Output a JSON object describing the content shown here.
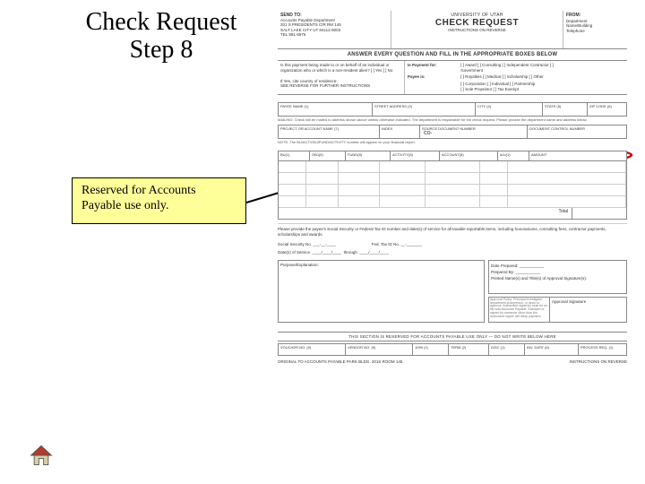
{
  "title_line1": "Check Request",
  "title_line2": "Step 8",
  "callout_text": "Reserved for Accounts Payable use only.",
  "form": {
    "header": {
      "send_to_label": "SEND TO:",
      "send_to_body": "Accounts Payable Department\n201 S PRESIDENTS CIR RM 145\nSALT LAKE CITY UT 84112-9003\nTEL 581-6976",
      "university": "UNIVERSITY OF UTAH",
      "title": "CHECK REQUEST",
      "subtitle": "INSTRUCTIONS ON REVERSE",
      "from_label": "FROM:",
      "from_body": "Department\nName/Building\nTelephone"
    },
    "banner": "ANSWER EVERY QUESTION AND FILL IN THE APPROPRIATE BOXES BELOW",
    "q1": {
      "left": "Is this payment being made to or on behalf of an individual or organization who or which is a non-resident alien?  [ ] Yes  [ ] No\n\nIf Yes, cite country of residence:\nSEE REVERSE FOR FURTHER INSTRUCTIONS",
      "pay_label": "Is Payment for:",
      "pay_opts": "[ ] Award  [ ] Consulting  [ ] Independent Contractor  [ ] Government\n[ ] Royalties  [ ] Medical  [ ] Scholarship  [ ] Other",
      "payee_label": "Payee is:",
      "payee_opts": "[ ] Corporation  [ ] Individual  [ ] Partnership\n[ ] Sole Proprietor  [ ] Tax Exempt"
    },
    "addr": {
      "c1": "PAYEE NAME (1)",
      "c2": "STREET ADDRESS (3)",
      "c3": "CITY (4)",
      "c4": "STATE (5)",
      "c5": "ZIP CODE (6)"
    },
    "blurb1": "MAILING: Check will be mailed to address shown above unless otherwise indicated. The department is responsible for the check request. Please provide the department name and address below.",
    "row2": {
      "c1": "PROJECT OR ACCOUNT NAME (7)",
      "c2": "INDEX",
      "c3": "SOURCE DOCUMENT NUMBER",
      "c4": "DOCUMENT CONTROL NUMBER"
    },
    "row2_val": "CO-",
    "blurb2": "NOTE: The BU/ACT/OBJ/FUND/ACTIVITY number will appear on your financial report.",
    "grid_head": {
      "c1": "BU(1)",
      "c2": "OBJ(9)",
      "c3": "FUND(8)",
      "c4": "ACTIVITY(8)",
      "c5": "ACCOUNT(8)",
      "c6": "A/U(1)",
      "c7": "AMOUNT"
    },
    "grid_total": "Total",
    "note": "Please provide the payee's Social Security or Federal Tax ID number and date(s) of service for all taxable reportable items, including honorariums, consulting fees, contractor payments, scholarships and awards.",
    "ssn_label": "Social Security No.",
    "fedtax_label": "Fed. Tax ID No.",
    "dos_label": "Date(s) of Service",
    "dos_sep": "through",
    "purpose_label": "Purpose/Explanation:",
    "sig": {
      "date": "Date Prepared:",
      "prep": "Prepared By:",
      "printed": "Printed Name(s) and Title(s) of Approval Signature(s):",
      "policy": "Approval Policy: Principal investigator, department chairperson, or dean to approve. Authorized signer(s) must be on file with Accounts Payable. Stamped or signed by someone other than the authorized signer will delay payment.",
      "approval": "Approval Signature"
    },
    "reserved": "THIS SECTION IS RESERVED FOR ACCOUNTS PAYABLE USE ONLY — DO NOT WRITE BELOW HERE",
    "vrow": {
      "c1": "VOUCHER NO. (9)",
      "c2": "VENDOR NO. (9)",
      "c3": "1099 (1)",
      "c4": "TERM (2)",
      "c5": "DISC (1)",
      "c6": "INV. DATE (6)",
      "c7": "PROCESS REQ. (1)"
    },
    "foot_left": "ORIGINAL TO ACCOUNTS PAYABLE  PARK BLDG. 201S ROOM 145",
    "foot_right": "INSTRUCTIONS ON REVERSE"
  }
}
